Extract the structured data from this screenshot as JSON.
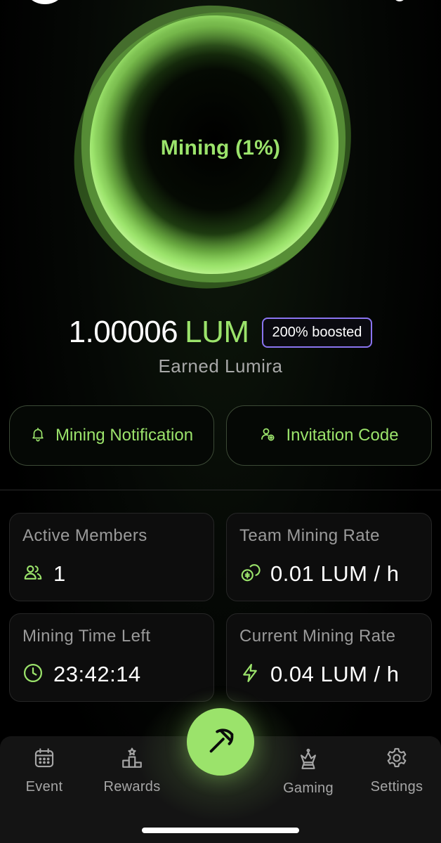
{
  "orb": {
    "status_label": "Mining (1%)",
    "progress_percent": 1,
    "color": "#9be36b"
  },
  "balance": {
    "amount": "1.00006",
    "unit": "LUM",
    "boost_badge": "200% boosted",
    "caption": "Earned Lumira"
  },
  "actions": {
    "notification_label": "Mining Notification",
    "notification_icon": "bell-icon",
    "invite_label": "Invitation Code",
    "invite_icon": "user-plus-icon"
  },
  "stats": {
    "active_members": {
      "title": "Active Members",
      "value": "1",
      "icon": "users-icon"
    },
    "team_rate": {
      "title": "Team Mining Rate",
      "value": "0.01 LUM / h",
      "icon": "coins-icon"
    },
    "time_left": {
      "title": "Mining Time Left",
      "value": "23:42:14",
      "icon": "clock-icon"
    },
    "current_rate": {
      "title": "Current Mining Rate",
      "value": "0.04 LUM / h",
      "icon": "lightning-icon"
    }
  },
  "nav": {
    "items": [
      {
        "label": "Event",
        "icon": "calendar-icon"
      },
      {
        "label": "Rewards",
        "icon": "podium-icon"
      },
      {
        "label": "Gaming",
        "icon": "crown-icon"
      },
      {
        "label": "Settings",
        "icon": "gear-icon"
      }
    ],
    "center_icon": "pickaxe-icon"
  },
  "colors": {
    "accent": "#9be36b",
    "boost_border": "#8a74f0",
    "card_bg": "#0d0d0d",
    "nav_bg": "#141414"
  }
}
